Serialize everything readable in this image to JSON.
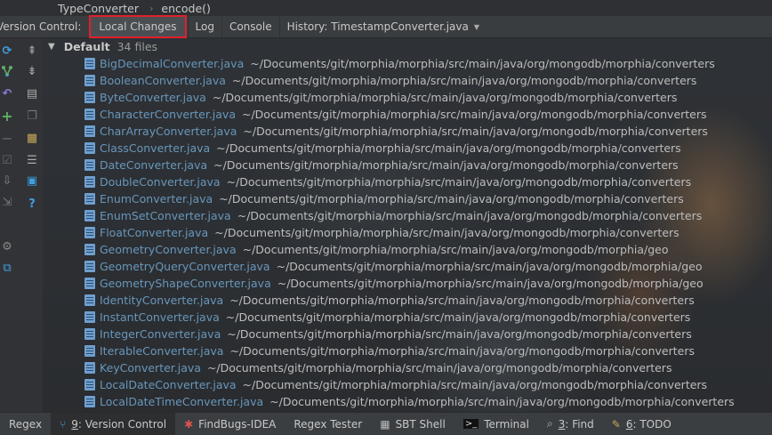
{
  "breadcrumb": {
    "class_name": "TypeConverter",
    "method_name": "encode()",
    "separator": "›"
  },
  "tool_window": {
    "label": "Version Control:",
    "tabs": [
      {
        "label": "Local Changes",
        "active": true
      },
      {
        "label": "Log",
        "active": false
      },
      {
        "label": "Console",
        "active": false
      },
      {
        "label": "History: TimestampConverter.java",
        "active": false,
        "dropdown": true
      }
    ]
  },
  "toolbar_icons": [
    "refresh-icon",
    "commit-icon",
    "rollback-icon",
    "add-changelist-icon",
    "remove-changelist-icon",
    "check-icon",
    "shelve-icon",
    "move-icon",
    "settings-icon",
    "copy-icon",
    "diff-icon",
    "layout-icon",
    "help-icon",
    "expand-all-icon",
    "collapse-all-icon",
    "group-icon",
    "preview-icon"
  ],
  "changelist": {
    "name": "Default",
    "count_text": "34 files",
    "files": [
      {
        "name": "BigDecimalConverter.java",
        "path": "~/Documents/git/morphia/morphia/src/main/java/org/mongodb/morphia/converters"
      },
      {
        "name": "BooleanConverter.java",
        "path": "~/Documents/git/morphia/morphia/src/main/java/org/mongodb/morphia/converters"
      },
      {
        "name": "ByteConverter.java",
        "path": "~/Documents/git/morphia/morphia/src/main/java/org/mongodb/morphia/converters"
      },
      {
        "name": "CharacterConverter.java",
        "path": "~/Documents/git/morphia/morphia/src/main/java/org/mongodb/morphia/converters"
      },
      {
        "name": "CharArrayConverter.java",
        "path": "~/Documents/git/morphia/morphia/src/main/java/org/mongodb/morphia/converters"
      },
      {
        "name": "ClassConverter.java",
        "path": "~/Documents/git/morphia/morphia/src/main/java/org/mongodb/morphia/converters"
      },
      {
        "name": "DateConverter.java",
        "path": "~/Documents/git/morphia/morphia/src/main/java/org/mongodb/morphia/converters"
      },
      {
        "name": "DoubleConverter.java",
        "path": "~/Documents/git/morphia/morphia/src/main/java/org/mongodb/morphia/converters"
      },
      {
        "name": "EnumConverter.java",
        "path": "~/Documents/git/morphia/morphia/src/main/java/org/mongodb/morphia/converters"
      },
      {
        "name": "EnumSetConverter.java",
        "path": "~/Documents/git/morphia/morphia/src/main/java/org/mongodb/morphia/converters"
      },
      {
        "name": "FloatConverter.java",
        "path": "~/Documents/git/morphia/morphia/src/main/java/org/mongodb/morphia/converters"
      },
      {
        "name": "GeometryConverter.java",
        "path": "~/Documents/git/morphia/morphia/src/main/java/org/mongodb/morphia/geo"
      },
      {
        "name": "GeometryQueryConverter.java",
        "path": "~/Documents/git/morphia/morphia/src/main/java/org/mongodb/morphia/geo"
      },
      {
        "name": "GeometryShapeConverter.java",
        "path": "~/Documents/git/morphia/morphia/src/main/java/org/mongodb/morphia/geo"
      },
      {
        "name": "IdentityConverter.java",
        "path": "~/Documents/git/morphia/morphia/src/main/java/org/mongodb/morphia/converters"
      },
      {
        "name": "InstantConverter.java",
        "path": "~/Documents/git/morphia/morphia/src/main/java/org/mongodb/morphia/converters"
      },
      {
        "name": "IntegerConverter.java",
        "path": "~/Documents/git/morphia/morphia/src/main/java/org/mongodb/morphia/converters"
      },
      {
        "name": "IterableConverter.java",
        "path": "~/Documents/git/morphia/morphia/src/main/java/org/mongodb/morphia/converters"
      },
      {
        "name": "KeyConverter.java",
        "path": "~/Documents/git/morphia/morphia/src/main/java/org/mongodb/morphia/converters"
      },
      {
        "name": "LocalDateConverter.java",
        "path": "~/Documents/git/morphia/morphia/src/main/java/org/mongodb/morphia/converters"
      },
      {
        "name": "LocalDateTimeConverter.java",
        "path": "~/Documents/git/morphia/morphia/src/main/java/org/mongodb/morphia/converters"
      }
    ]
  },
  "bottom_tabs": [
    {
      "label": "Regex",
      "icon": "",
      "mnemonic": "",
      "active": false
    },
    {
      "label": "Version Control",
      "icon": "version-control-icon",
      "mnemonic": "9",
      "active": true
    },
    {
      "label": "FindBugs-IDEA",
      "icon": "findbugs-icon",
      "mnemonic": "",
      "active": false
    },
    {
      "label": "Regex Tester",
      "icon": "",
      "mnemonic": "",
      "active": false
    },
    {
      "label": "SBT Shell",
      "icon": "sbt-shell-icon",
      "mnemonic": "",
      "active": false
    },
    {
      "label": "Terminal",
      "icon": "terminal-icon",
      "mnemonic": "",
      "active": false
    },
    {
      "label": "Find",
      "icon": "find-icon",
      "mnemonic": "3",
      "active": false
    },
    {
      "label": "TODO",
      "icon": "todo-icon",
      "mnemonic": "6",
      "active": false
    }
  ],
  "colors": {
    "accent_highlight": "#e0202a",
    "file_link": "#6897bb",
    "path_text": "#bdbdbd"
  }
}
